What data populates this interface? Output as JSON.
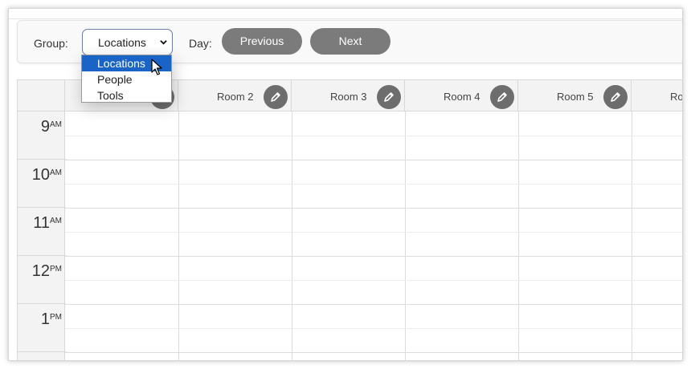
{
  "toolbar": {
    "group_label": "Group:",
    "group_value": "Locations",
    "day_label": "Day:",
    "previous_label": "Previous",
    "next_label": "Next"
  },
  "dropdown": {
    "options": [
      "Locations",
      "People",
      "Tools"
    ],
    "selected_index": 0
  },
  "calendar": {
    "columns": [
      {
        "label": ""
      },
      {
        "label": "Room 2"
      },
      {
        "label": "Room 3"
      },
      {
        "label": "Room 4"
      },
      {
        "label": "Room 5"
      },
      {
        "label": "Ro"
      }
    ],
    "hours": [
      {
        "num": "9",
        "ampm": "AM"
      },
      {
        "num": "10",
        "ampm": "AM"
      },
      {
        "num": "11",
        "ampm": "AM"
      },
      {
        "num": "12",
        "ampm": "PM"
      },
      {
        "num": "1",
        "ampm": "PM"
      }
    ],
    "edit_icon": "pencil-icon"
  },
  "colors": {
    "button_bg": "#7b7b7b",
    "edit_bg": "#6d6d6d",
    "selected_option": "#1a63c7",
    "header_bg": "#f3f3f3"
  }
}
